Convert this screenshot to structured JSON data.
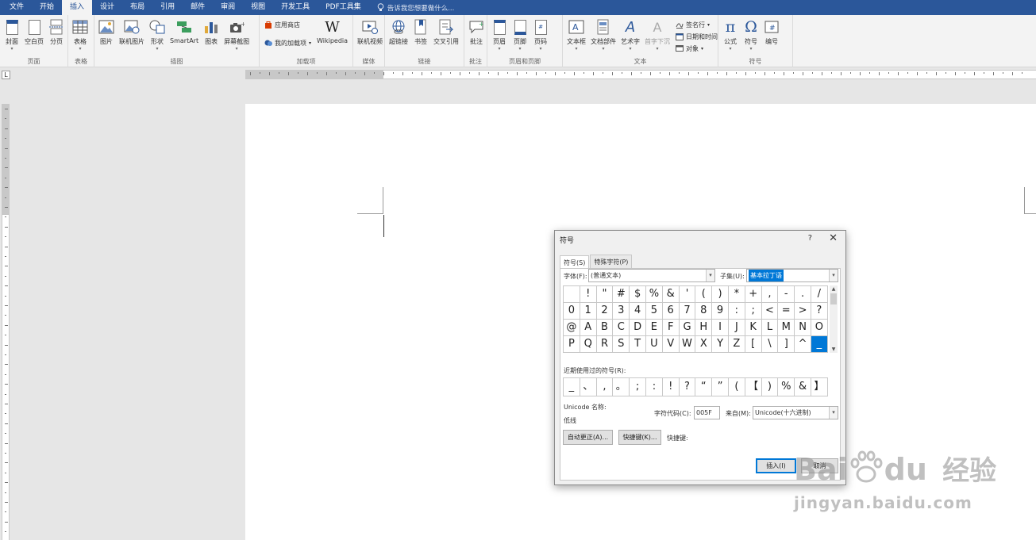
{
  "tabs": [
    "文件",
    "开始",
    "插入",
    "设计",
    "布局",
    "引用",
    "邮件",
    "审阅",
    "视图",
    "开发工具",
    "PDF工具集"
  ],
  "active_tab": 2,
  "tell_me": "告诉我您想要做什么...",
  "ribbon": {
    "page": {
      "label": "页面",
      "buttons": [
        "封面",
        "空白页",
        "分页"
      ]
    },
    "table": {
      "label": "表格",
      "buttons": [
        "表格"
      ]
    },
    "illustrations": {
      "label": "插图",
      "buttons": [
        "图片",
        "联机图片",
        "形状",
        "SmartArt",
        "图表",
        "屏幕截图"
      ]
    },
    "addins": {
      "label": "加载项",
      "store": "应用商店",
      "my_addins": "我的加载项",
      "wikipedia": "Wikipedia"
    },
    "media": {
      "label": "媒体",
      "buttons": [
        "联机视频"
      ]
    },
    "links": {
      "label": "链接",
      "buttons": [
        "超链接",
        "书签",
        "交叉引用"
      ]
    },
    "comments": {
      "label": "批注",
      "buttons": [
        "批注"
      ]
    },
    "header_footer": {
      "label": "页眉和页脚",
      "buttons": [
        "页眉",
        "页脚",
        "页码"
      ]
    },
    "text": {
      "label": "文本",
      "buttons": [
        "文本框",
        "文档部件",
        "艺术字",
        "首字下沉"
      ],
      "signature": "签名行",
      "datetime": "日期和时间",
      "object": "对象"
    },
    "symbols": {
      "label": "符号",
      "buttons": [
        "公式",
        "符号",
        "编号"
      ]
    }
  },
  "ruler": {
    "corner": "L"
  },
  "dialog": {
    "title": "符号",
    "help": "?",
    "close": "✕",
    "tabs": [
      "符号(S)",
      "特殊字符(P)"
    ],
    "font_label": "字体(F):",
    "font_value": "(普通文本)",
    "subset_label": "子集(U):",
    "subset_value": "基本拉丁语",
    "symbols": [
      [
        " ",
        "!",
        "\"",
        "#",
        "$",
        "%",
        "&",
        "'",
        "(",
        ")",
        "*",
        "+",
        ",",
        "-",
        ".",
        "/"
      ],
      [
        "0",
        "1",
        "2",
        "3",
        "4",
        "5",
        "6",
        "7",
        "8",
        "9",
        ":",
        ";",
        "<",
        "=",
        ">",
        "?"
      ],
      [
        "@",
        "A",
        "B",
        "C",
        "D",
        "E",
        "F",
        "G",
        "H",
        "I",
        "J",
        "K",
        "L",
        "M",
        "N",
        "O"
      ],
      [
        "P",
        "Q",
        "R",
        "S",
        "T",
        "U",
        "V",
        "W",
        "X",
        "Y",
        "Z",
        "[",
        "\\",
        "]",
        "^",
        "_"
      ]
    ],
    "selected_row": 3,
    "selected_col": 15,
    "recent_label": "近期使用过的符号(R):",
    "recent": [
      "_",
      "、",
      ",",
      "。",
      ";",
      ":",
      "!",
      "?",
      "“",
      "”",
      "(",
      "【",
      ")",
      "%",
      "&",
      "】"
    ],
    "unicode_label": "Unicode 名称:",
    "unicode_name": "低线",
    "code_label": "字符代码(C):",
    "code_value": "005F",
    "from_label": "来自(M):",
    "from_value": "Unicode(十六进制)",
    "autocorrect": "自动更正(A)...",
    "shortcut_btn": "快捷键(K)...",
    "shortcut_label": "快捷键:",
    "insert": "插入(I)",
    "cancel": "取消"
  },
  "watermark": {
    "brand": "Bai",
    "brand2": "du",
    "cn": "经验",
    "url": "jingyan.baidu.com"
  }
}
